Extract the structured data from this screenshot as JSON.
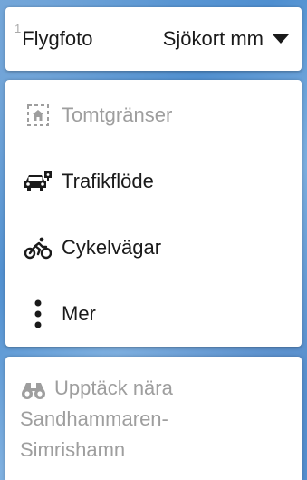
{
  "map_type": {
    "tick": "1",
    "primary": "Flygfoto",
    "secondary": "Sjökort mm"
  },
  "layers": {
    "items": [
      {
        "label": "Tomtgränser",
        "icon": "property-boundary-icon",
        "disabled": true
      },
      {
        "label": "Trafikflöde",
        "icon": "traffic-car-icon",
        "disabled": false
      },
      {
        "label": "Cykelvägar",
        "icon": "bicycle-icon",
        "disabled": false
      },
      {
        "label": "Mer",
        "icon": "more-vertical-icon",
        "disabled": false
      }
    ]
  },
  "nearby": {
    "icon": "binoculars-icon",
    "line1": "Upptäck nära",
    "line2": "Sandhammaren-",
    "line3": "Simrishamn"
  },
  "colors": {
    "text": "#1a1a1a",
    "disabled": "#9e9e9e",
    "card": "#ffffff"
  }
}
